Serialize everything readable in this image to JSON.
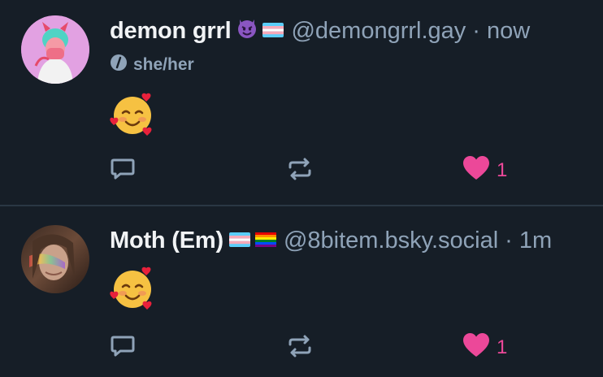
{
  "posts": [
    {
      "display_name": "demon grrl",
      "name_emojis": [
        "smiling-imp-emoji",
        "trans-flag-emoji"
      ],
      "handle": "@demongrrl.gay",
      "separator": "·",
      "time": "now",
      "pronouns": "she/her",
      "body_emoji": "smiling-face-with-hearts-emoji",
      "like_count": "1"
    },
    {
      "display_name": "Moth (Em)",
      "name_emojis": [
        "trans-flag-emoji",
        "rainbow-flag-emoji"
      ],
      "handle": "@8bitem.bsky.social",
      "separator": "·",
      "time": "1m",
      "body_emoji": "smiling-face-with-hearts-emoji",
      "like_count": "1"
    }
  ],
  "colors": {
    "background": "#161e27",
    "text": "#f1f3f5",
    "muted": "#8fa3b8",
    "like": "#ec4899",
    "divider": "#2a3744"
  },
  "icons": {
    "reply": "reply-bubble-icon",
    "repost": "repost-arrows-icon",
    "like": "heart-icon",
    "pronouns": "pronouns-slash-icon"
  }
}
